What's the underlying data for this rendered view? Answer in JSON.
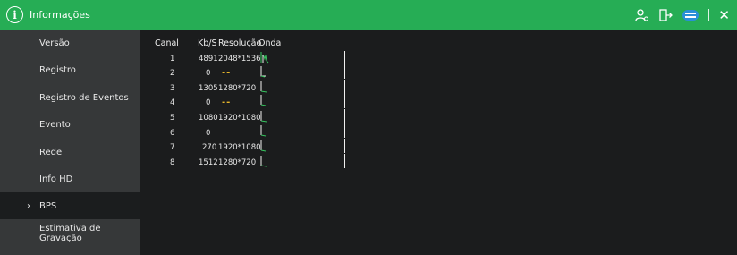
{
  "title_bar": {
    "title": "Informações",
    "icons": [
      "info-icon",
      "user-settings-icon",
      "logout-icon",
      "hdd-icon",
      "close-icon"
    ],
    "accent": "#26ad55"
  },
  "sidebar": {
    "items": [
      {
        "label": "Versão"
      },
      {
        "label": "Registro"
      },
      {
        "label": "Registro de Eventos"
      },
      {
        "label": "Evento"
      },
      {
        "label": "Rede"
      },
      {
        "label": "Info HD"
      },
      {
        "label": "BPS",
        "active": true
      },
      {
        "label": "Estimativa de Gravação"
      }
    ]
  },
  "bps_table": {
    "headers": {
      "canal": "Canal",
      "kbs": "Kb/S",
      "resolucao": "Resolução",
      "onda": "Onda"
    },
    "rows": [
      {
        "canal": "1",
        "kbs": "4891",
        "resolucao": "2048*1536"
      },
      {
        "canal": "2",
        "kbs": "0",
        "resolucao": "--"
      },
      {
        "canal": "3",
        "kbs": "1305",
        "resolucao": "1280*720"
      },
      {
        "canal": "4",
        "kbs": "0",
        "resolucao": "--"
      },
      {
        "canal": "5",
        "kbs": "1080",
        "resolucao": "1920*1080"
      },
      {
        "canal": "6",
        "kbs": "0",
        "resolucao": ""
      },
      {
        "canal": "7",
        "kbs": "270",
        "resolucao": "1920*1080"
      },
      {
        "canal": "8",
        "kbs": "1512",
        "resolucao": "1280*720"
      }
    ]
  }
}
